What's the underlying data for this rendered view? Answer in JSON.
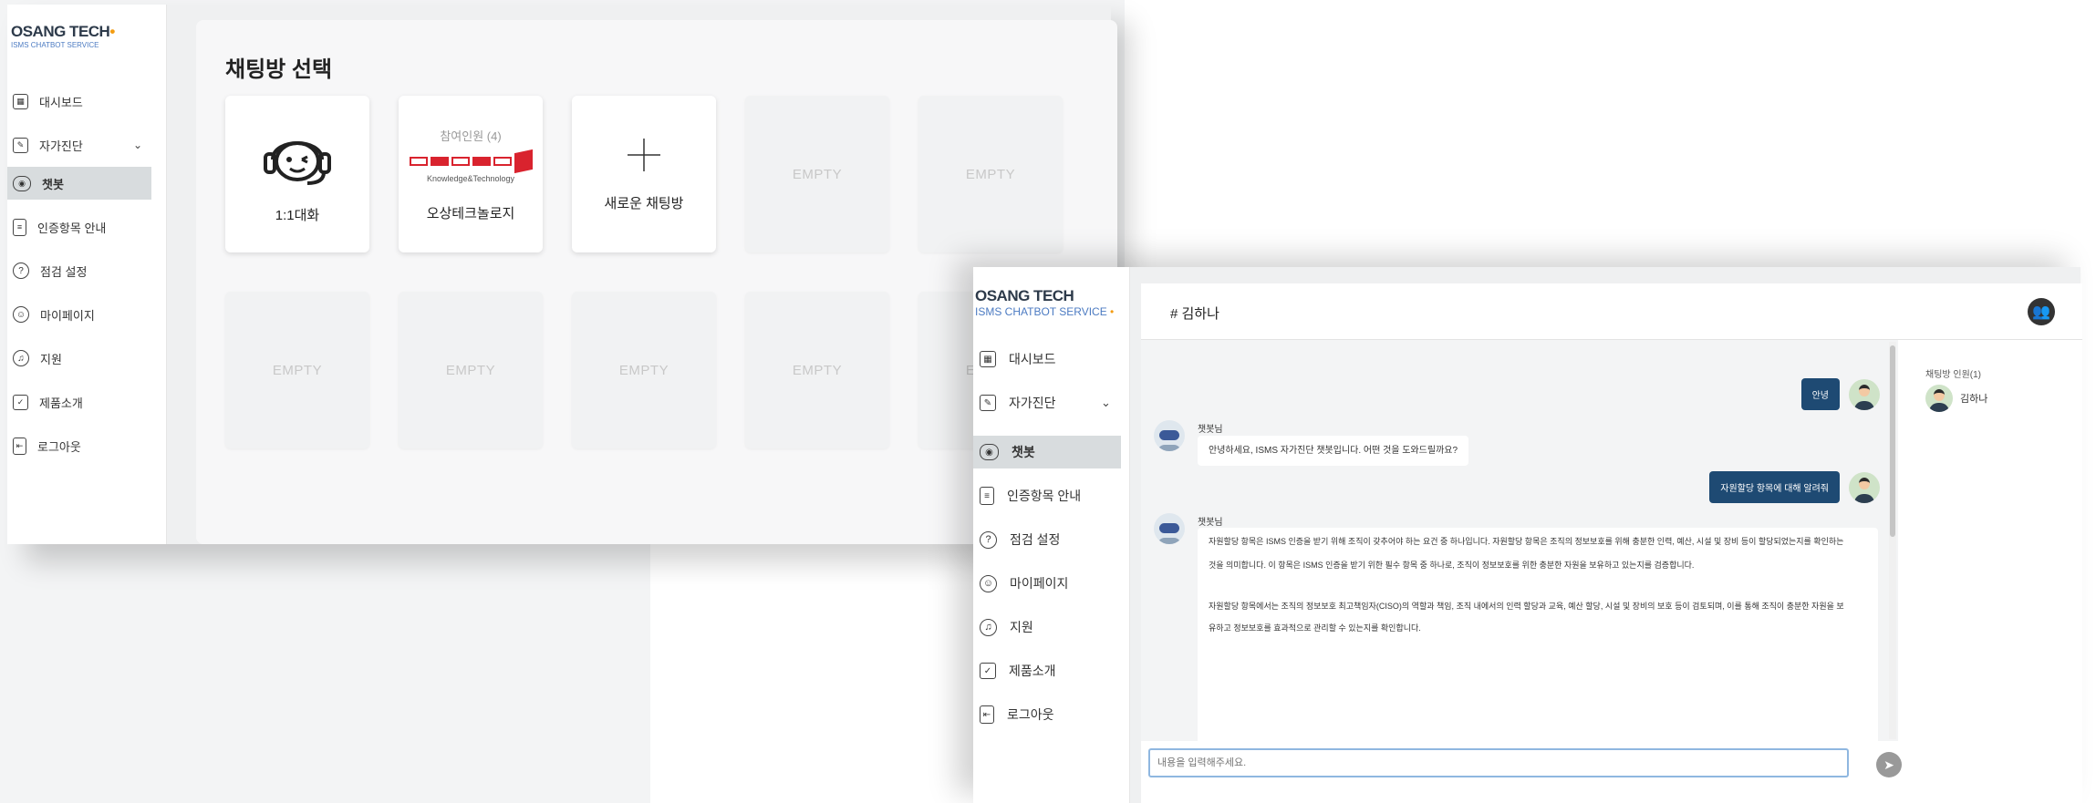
{
  "logo": {
    "name": "OSANG TECH",
    "sub": "ISMS CHATBOT SERVICE"
  },
  "nav": [
    {
      "label": "대시보드",
      "icon": "dashboard-icon"
    },
    {
      "label": "자가진단",
      "icon": "self-check-icon",
      "has_chevron": true
    },
    {
      "label": "챗봇",
      "icon": "chatbot-icon",
      "active": true
    },
    {
      "label": "인증항목 안내",
      "icon": "clipboard-icon"
    },
    {
      "label": "점검 설정",
      "icon": "settings-icon"
    },
    {
      "label": "마이페이지",
      "icon": "smile-icon"
    },
    {
      "label": "지원",
      "icon": "headset-icon"
    },
    {
      "label": "제품소개",
      "icon": "calendar-icon"
    },
    {
      "label": "로그아웃",
      "icon": "logout-icon"
    }
  ],
  "chat_select": {
    "title": "채팅방 선택",
    "cards_row1": [
      {
        "type": "support",
        "label": "1:1대화"
      },
      {
        "type": "group",
        "members": "참여인원 (4)",
        "logo_sub": "Knowledge&Technology",
        "label": "오상테크놀로지"
      },
      {
        "type": "new",
        "label": "새로운 채팅방"
      },
      {
        "type": "empty",
        "label": "EMPTY"
      },
      {
        "type": "empty",
        "label": "EMPTY"
      }
    ],
    "cards_row2": [
      "EMPTY",
      "EMPTY",
      "EMPTY",
      "EMPTY",
      "EMPTY"
    ]
  },
  "chat": {
    "room_name": "# 김하나",
    "user_msg1": "안녕",
    "bot_name": "챗봇님",
    "bot_msg1": "안녕하세요, ISMS 자가진단 챗봇입니다. 어떤 것을 도와드릴까요?",
    "user_msg2": "자원할당 항목에 대해 알려줘",
    "bot_msg2_line1": "자원할당 항목은 ISMS 인증을 받기 위해 조직이 갖추어야 하는 요건 중 하나입니다. 자원할당 항목은 조직의 정보보호를 위해 충분한 인력, 예산, 시설 및 장비 등이 할당되었는지를 확인하는",
    "bot_msg2_line2": "것을 의미합니다. 이 항목은 ISMS 인증을 받기 위한 필수 항목 중 하나로, 조직이 정보보호를 위한 충분한 자원을 보유하고 있는지를 검증합니다.",
    "bot_msg2_line3": "자원할당 항목에서는 조직의 정보보호 최고책임자(CISO)의 역할과 책임, 조직 내에서의 인력 할당과 교육, 예산 할당, 시설 및 장비의 보호 등이 검토되며, 이를 통해 조직이 충분한 자원을 보",
    "bot_msg2_line4": "유하고 정보보호를 효과적으로 관리할 수 있는지를 확인합니다.",
    "input_placeholder": "내용을 입력해주세요.",
    "members_title": "채팅방 인원(1)",
    "member_name": "김하나"
  }
}
